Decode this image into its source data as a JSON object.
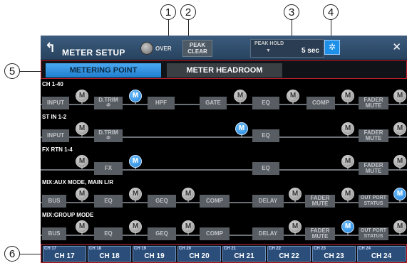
{
  "callouts": [
    "1",
    "2",
    "3",
    "4",
    "5",
    "6"
  ],
  "header": {
    "back_icon": "back-arrow-icon",
    "title": "METER SETUP",
    "over_label": "OVER",
    "peak_clear_label_1": "PEAK",
    "peak_clear_label_2": "CLEAR",
    "peak_hold_label": "PEAK HOLD",
    "peak_hold_value": "5 sec",
    "settings_icon": "gear-icon",
    "close_icon": "close-icon"
  },
  "tabs": [
    {
      "label": "METERING POINT"
    },
    {
      "label": "METER HEADROOM"
    }
  ],
  "sections": {
    "ch140": "CH 1-40",
    "stin": "ST IN 1-2",
    "fxrtn": "FX RTN 1-4",
    "mixaux": "MIX:AUX MODE, MAIN L/R",
    "mixgroup": "MIX:GROUP MODE"
  },
  "blocks": {
    "input": "INPUT",
    "dtrim": "D.TRIM",
    "phi": "Φ",
    "hpf": "HPF",
    "gate": "GATE",
    "eq": "EQ",
    "comp": "COMP",
    "fader": "FADER",
    "mute": "MUTE",
    "fx": "FX",
    "bus": "BUS",
    "geq": "GEQ",
    "delay": "DELAY",
    "outport": "OUT PORT",
    "status": "STATUS"
  },
  "meter_point_label": "M",
  "channels": [
    {
      "sub": "CH 17",
      "main": "CH 17"
    },
    {
      "sub": "CH 18",
      "main": "CH 18"
    },
    {
      "sub": "CH 19",
      "main": "CH 19"
    },
    {
      "sub": "CH 20",
      "main": "CH 20"
    },
    {
      "sub": "CH 21",
      "main": "CH 21"
    },
    {
      "sub": "CH 22",
      "main": "CH 22"
    },
    {
      "sub": "CH 23",
      "main": "CH 23"
    },
    {
      "sub": "CH 24",
      "main": "CH 24"
    }
  ]
}
